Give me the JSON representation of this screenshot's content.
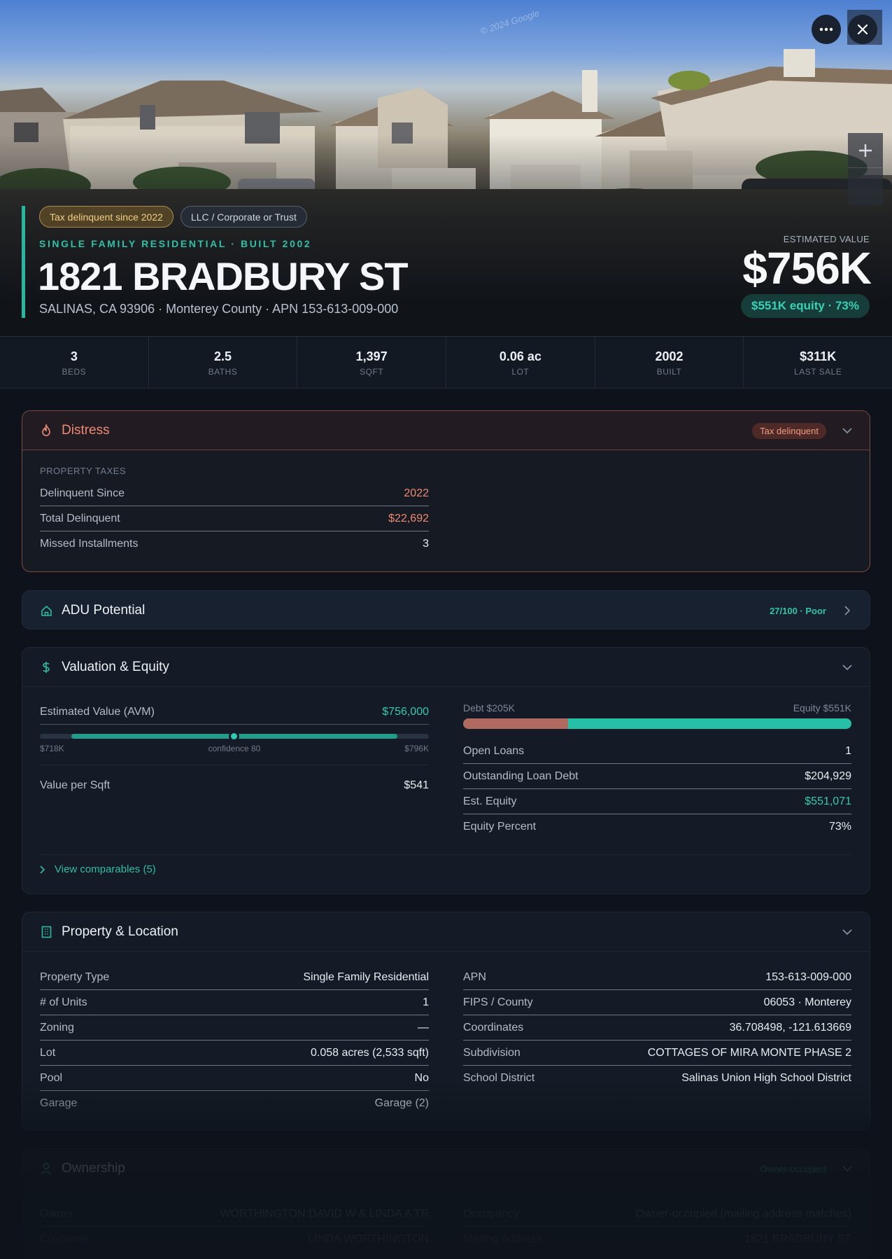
{
  "hero": {
    "watermark": "© 2024 Google",
    "tags": [
      "Tax delinquent since 2022",
      "LLC / Corporate or Trust"
    ],
    "subtitle": "SINGLE FAMILY RESIDENTIAL · BUILT 2002",
    "title": "1821 BRADBURY ST",
    "location": "SALINAS, CA 93906 · Monterey County · APN 153-613-009-000",
    "estimated_label": "ESTIMATED VALUE",
    "estimated_value": "$756K",
    "equity_pill": "$551K equity · 73%",
    "more_icon": "more-horizontal-icon",
    "close_icon": "close-icon",
    "zoom_icon": "zoom-in-icon"
  },
  "stats": [
    {
      "value": "3",
      "label": "BEDS"
    },
    {
      "value": "2.5",
      "label": "BATHS"
    },
    {
      "value": "1,397",
      "label": "SQFT"
    },
    {
      "value": "0.06 ac",
      "label": "LOT"
    },
    {
      "value": "2002",
      "label": "BUILT"
    },
    {
      "value": "$311K",
      "label": "LAST SALE"
    }
  ],
  "distress": {
    "title": "Distress",
    "badge": "Tax delinquent",
    "section_label": "PROPERTY TAXES",
    "rows": [
      {
        "k": "Delinquent Since",
        "v": "2022"
      },
      {
        "k": "Total Delinquent",
        "v": "$22,692"
      },
      {
        "k": "Missed Installments",
        "v": "3"
      }
    ]
  },
  "adu": {
    "title": "ADU Potential",
    "score": "27/100 · Poor"
  },
  "valuation": {
    "title": "Valuation & Equity",
    "avm_label": "Estimated Value (AVM)",
    "avm_value": "$756,000",
    "range_low": "$718K",
    "range_mid": "confidence 80",
    "range_high": "$796K",
    "confidence": 80,
    "value_sqft_label": "Value per Sqft",
    "value_sqft": "$541",
    "debt_label": "Debt $205K",
    "equity_label": "Equity $551K",
    "equity_fraction": 0.73,
    "rows": [
      {
        "k": "Open Loans",
        "v": "1"
      },
      {
        "k": "Outstanding Loan Debt",
        "v": "$204,929"
      },
      {
        "k": "Est. Equity",
        "v": "$551,071"
      },
      {
        "k": "Equity Percent",
        "v": "73%"
      }
    ],
    "view_comparables": "View comparables (5)"
  },
  "property": {
    "title": "Property & Location",
    "left": [
      {
        "k": "Property Type",
        "v": "Single Family Residential"
      },
      {
        "k": "# of Units",
        "v": "1"
      },
      {
        "k": "Zoning",
        "v": "—"
      },
      {
        "k": "Lot",
        "v": "0.058 acres (2,533 sqft)"
      },
      {
        "k": "Pool",
        "v": "No"
      },
      {
        "k": "Garage",
        "v": "Garage (2)"
      }
    ],
    "right": [
      {
        "k": "APN",
        "v": "153-613-009-000"
      },
      {
        "k": "FIPS / County",
        "v": "06053 · Monterey"
      },
      {
        "k": "Coordinates",
        "v": "36.708498, -121.613669"
      },
      {
        "k": "Subdivision",
        "v": "COTTAGES OF MIRA MONTE PHASE 2"
      },
      {
        "k": "School District",
        "v": "Salinas Union High School District"
      }
    ]
  },
  "ownership": {
    "title": "Ownership",
    "badge": "Owner-occupied",
    "left": [
      {
        "k": "Owner",
        "v": "WORTHINGTON DAVID W & LINDA A TR"
      },
      {
        "k": "Co-owner",
        "v": "LINDA WORTHINGTON"
      }
    ],
    "right": [
      {
        "k": "Occupancy",
        "v": "Owner-occupied (mailing address matches)"
      },
      {
        "k": "Mailing Address",
        "v": "1821 BRADBURY ST"
      }
    ]
  },
  "colors": {
    "accent": "#27b7a0",
    "distress": "#ee8a73",
    "warn": "#f0cf87",
    "debt": "#b06a5f"
  }
}
